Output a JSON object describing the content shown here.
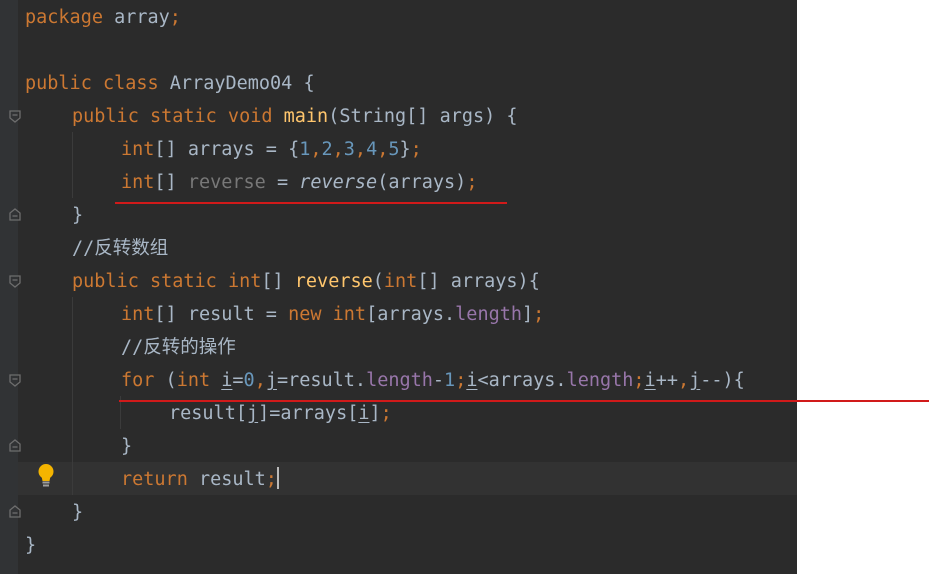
{
  "code": {
    "l1": {
      "kw": "package",
      "rest": " array",
      "semi": ";"
    },
    "l3": {
      "kw": "public class",
      "rest": " ArrayDemo04 {"
    },
    "l4": {
      "kw": "public static void",
      "fn": "main",
      "rest": "(String[] args) {"
    },
    "l5": {
      "kw": "int",
      "a": "[] arrays = {",
      "n1": "1",
      "c1": ",",
      "n2": "2",
      "c2": ",",
      "n3": "3",
      "c3": ",",
      "n4": "4",
      "c4": ",",
      "n5": "5",
      "b": "}",
      "semi": ";"
    },
    "l6": {
      "kw": "int",
      "a": "[] ",
      "unused": "reverse",
      "b": " = ",
      "call": "reverse",
      "c": "(arrays)",
      "semi": ";"
    },
    "l7": {
      "text": "}"
    },
    "l8": {
      "slashes": "//",
      "comment": "反转数组"
    },
    "l9": {
      "kw": "public static",
      "kw2": "int",
      "a": "[] ",
      "fn": "reverse",
      "b": "(",
      "kw3": "int",
      "c": "[] arrays){"
    },
    "l10": {
      "kw": "int",
      "a": "[] result = ",
      "kw2": "new",
      "sp": " ",
      "kw3": "int",
      "b": "[arrays.",
      "field": "length",
      "c": "]",
      "semi": ";"
    },
    "l11": {
      "slashes": "//",
      "comment": "反转的操作"
    },
    "l12": {
      "kw": "for",
      "a": " (",
      "kw2": "int",
      "sp": " ",
      "i1": "i",
      "eq": "=",
      "zero": "0",
      "cm1": ",",
      "j1": "j",
      "b": "=result.",
      "len1": "length",
      "minus": "-",
      "one": "1",
      "sc1": ";",
      "i2": "i",
      "lt": "<arrays.",
      "len2": "length",
      "sc2": ";",
      "i3": "i",
      "pp": "++",
      "cm2": ",",
      "j2": "j",
      "end": "--){"
    },
    "l13": {
      "a": "result[",
      "j": "j",
      "b": "]=arrays[",
      "i": "i",
      "c": "]",
      "semi": ";"
    },
    "l14": {
      "text": "}"
    },
    "l15": {
      "kw": "return",
      "rest": " result",
      "semi": ";"
    },
    "l16": {
      "text": "}"
    },
    "l17": {
      "text": "}"
    }
  },
  "icons": {
    "bulb": "lightbulb-icon",
    "fold": "fold-marker-icon"
  },
  "colors": {
    "background": "#2b2b2b",
    "keyword": "#cc7832",
    "function": "#ffc66d",
    "number": "#6897bb",
    "field": "#9876aa",
    "text": "#a9b7c6",
    "annotation": "#d11a1a"
  }
}
